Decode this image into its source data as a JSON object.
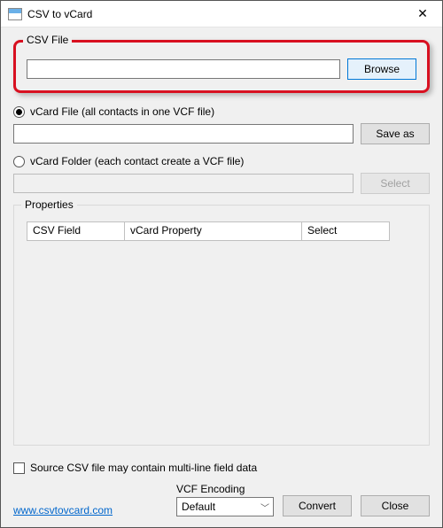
{
  "window": {
    "title": "CSV to vCard"
  },
  "csv": {
    "label": "CSV File",
    "value": "",
    "browse_label": "Browse"
  },
  "vcard_file": {
    "radio_label": "vCard File (all contacts in one VCF file)",
    "value": "",
    "saveas_label": "Save as"
  },
  "vcard_folder": {
    "radio_label": "vCard Folder (each contact create a VCF file)",
    "value": "",
    "select_label": "Select"
  },
  "properties": {
    "label": "Properties",
    "columns": {
      "csv_field": "CSV Field",
      "vcard_property": "vCard Property",
      "select": "Select"
    }
  },
  "multiline": {
    "label": "Source CSV file may contain multi-line field data"
  },
  "link": {
    "text": "www.csvtovcard.com"
  },
  "encoding": {
    "label": "VCF Encoding",
    "value": "Default"
  },
  "actions": {
    "convert": "Convert",
    "close": "Close"
  }
}
